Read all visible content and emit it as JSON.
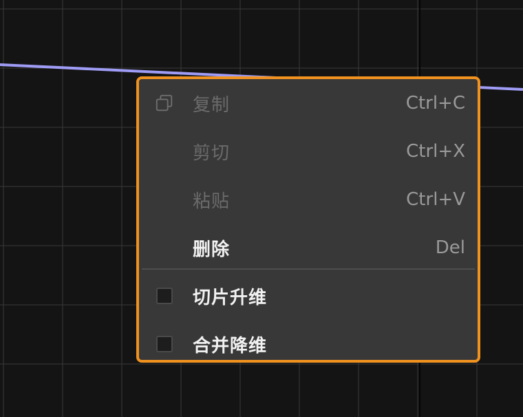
{
  "menu": {
    "items": [
      {
        "label": "复制",
        "shortcut": "Ctrl+C",
        "enabled": false,
        "icon": "copy-icon"
      },
      {
        "label": "剪切",
        "shortcut": "Ctrl+X",
        "enabled": false
      },
      {
        "label": "粘贴",
        "shortcut": "Ctrl+V",
        "enabled": false
      },
      {
        "label": "删除",
        "shortcut": "Del",
        "enabled": true
      }
    ],
    "options": [
      {
        "label": "切片升维",
        "checked": false
      },
      {
        "label": "合并降维",
        "checked": false
      }
    ]
  },
  "colors": {
    "background": "#141414",
    "grid": "#3a3a3a",
    "curve": "#9f9cf6",
    "menu_bg": "#383838",
    "menu_border": "#f0921f"
  }
}
